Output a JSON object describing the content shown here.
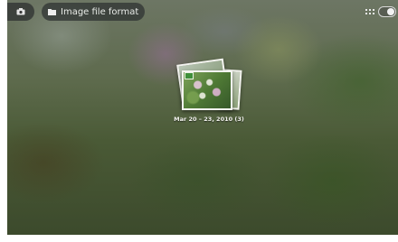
{
  "top_bar": {
    "camera_icon": "camera-icon",
    "breadcrumb": {
      "icon": "folder-icon",
      "label": "Image file format"
    },
    "view_switcher": {
      "grid_icon": "grid-icon",
      "toggle_icon": "view-toggle-icon"
    }
  },
  "album": {
    "caption": "Mar 20 – 23, 2010 (3)"
  },
  "colors": {
    "bar_background": "#2d3030",
    "bar_text": "#e9ece8"
  }
}
